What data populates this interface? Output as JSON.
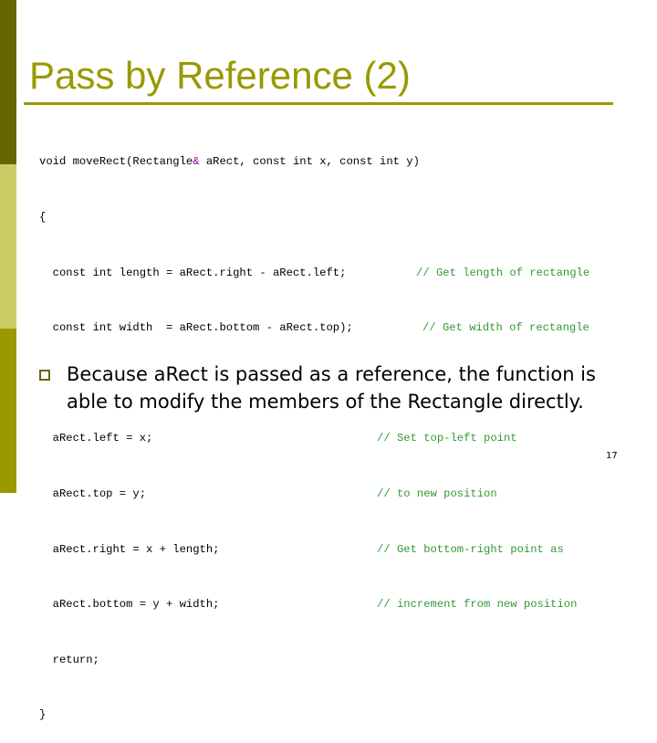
{
  "slide": {
    "title": "Pass by Reference (2)",
    "page_number": "17",
    "colors": {
      "accent": "#999900",
      "sidebar_top": "#666600",
      "sidebar_mid": "#cccc66",
      "sidebar_bottom": "#999900",
      "comment": "#339933",
      "ampersand": "#990099"
    }
  },
  "code": {
    "signature_before_amp": "void moveRect(Rectangle",
    "amp": "&",
    "signature_after_amp": " aRect, const int x, const int y)",
    "open_brace": "{",
    "line_length": "  const int length = aRect.right - aRect.left;",
    "comment_length": "// Get length of rectangle",
    "line_width": "  const int width  = aRect.bottom - aRect.top);",
    "comment_width": "// Get width of rectangle",
    "body_lines": [
      "  aRect.left = x;",
      "  aRect.top = y;",
      "  aRect.right = x + length;",
      "  aRect.bottom = y + width;",
      "  return;"
    ],
    "body_comments": [
      "// Set top-left point",
      "// to new position",
      "// Get bottom-right point as",
      "// increment from new position"
    ],
    "close_brace": "}"
  },
  "bullets": [
    {
      "text": "Because aRect is passed as a reference, the function is able to modify the members of the Rectangle directly."
    }
  ]
}
